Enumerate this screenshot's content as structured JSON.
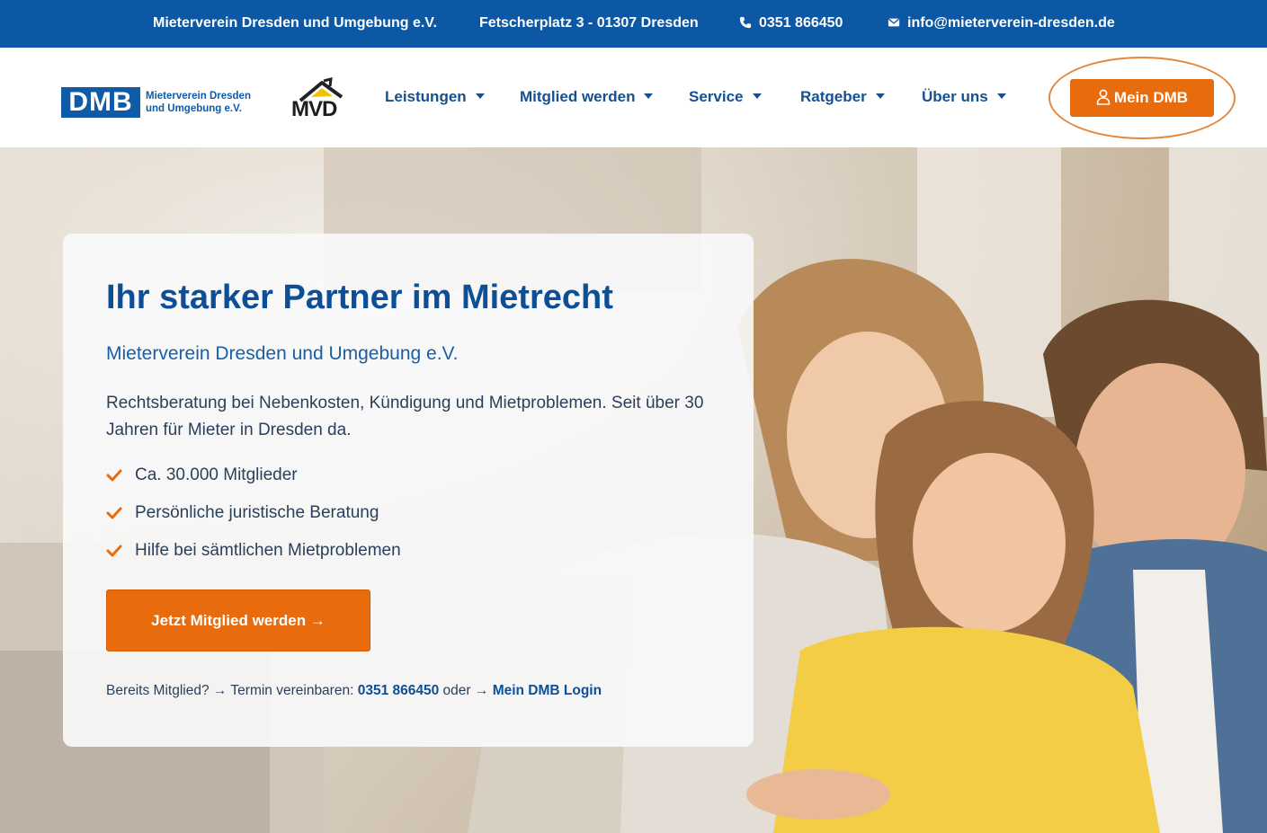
{
  "topbar": {
    "org": "Mieterverein Dresden und Umgebung e.V.",
    "address": "Fetscherplatz 3 - 01307 Dresden",
    "phone": "0351 866450",
    "email": "info@mieterverein-dresden.de"
  },
  "logos": {
    "dmb_letters": "DMB",
    "dmb_line1": "Mieterverein Dresden",
    "dmb_line2": "und Umgebung e.V.",
    "mvd_letters": "MVD"
  },
  "nav": {
    "items": [
      {
        "label": "Leistungen"
      },
      {
        "label": "Mitglied werden"
      },
      {
        "label": "Service"
      },
      {
        "label": "Ratgeber"
      },
      {
        "label": "Über uns"
      }
    ],
    "mein_dmb": "Mein DMB"
  },
  "hero": {
    "title": "Ihr starker Partner im Mietrecht",
    "subtitle": "Mieterverein Dresden und Umgebung e.V.",
    "description": "Rechtsberatung bei Nebenkosten, Kündigung und Mietproblemen. Seit über 30 Jahren für Mieter in Dresden da.",
    "benefits": [
      "Ca. 30.000 Mitglieder",
      "Persönliche juristische Beratung",
      "Hilfe bei sämtlichen Mietproblemen"
    ],
    "cta": "Jetzt Mitglied werden →",
    "footer": {
      "prefix": "Bereits Mitglied? → Termin vereinbaren:",
      "phone": "0351 866450",
      "middle": "oder →",
      "login": "Mein DMB Login"
    }
  },
  "colors": {
    "brand_blue": "#0d58a4",
    "accent_orange": "#e86c0e",
    "title_blue": "#0d4f97"
  }
}
